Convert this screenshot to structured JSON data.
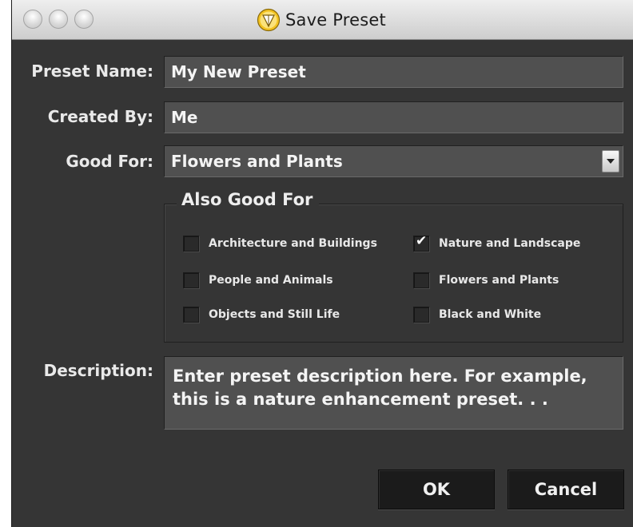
{
  "window": {
    "title": "Save Preset",
    "traffic_lights": [
      "close",
      "minimize",
      "zoom"
    ],
    "app_icon": "triangle-logo-icon"
  },
  "form": {
    "preset_name": {
      "label": "Preset Name:",
      "value": "My New Preset"
    },
    "created_by": {
      "label": "Created By:",
      "value": "Me"
    },
    "good_for": {
      "label": "Good For:",
      "value": "Flowers and Plants"
    },
    "also_good_for": {
      "legend": "Also Good For",
      "options": [
        {
          "label": "Architecture and Buildings",
          "checked": false
        },
        {
          "label": "Nature and Landscape",
          "checked": true
        },
        {
          "label": "People and Animals",
          "checked": false
        },
        {
          "label": "Flowers and Plants",
          "checked": false
        },
        {
          "label": "Objects and Still Life",
          "checked": false
        },
        {
          "label": "Black and White",
          "checked": false
        }
      ]
    },
    "description": {
      "label": "Description:",
      "value": "Enter preset description here. For example, this is a nature enhancement preset. . ."
    }
  },
  "buttons": {
    "ok": "OK",
    "cancel": "Cancel"
  },
  "colors": {
    "window_bg": "#353535",
    "field_bg": "#505050",
    "button_bg": "#1b1b1b",
    "text": "#e9e9e9"
  }
}
